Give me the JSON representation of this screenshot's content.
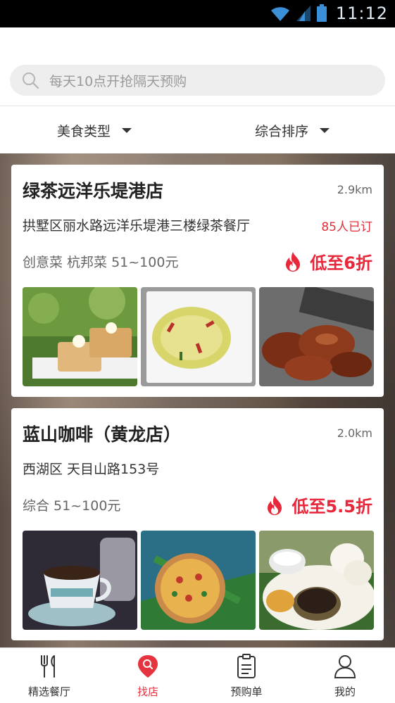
{
  "status_bar": {
    "time": "11:12"
  },
  "search": {
    "placeholder": "每天10点开抢隔天预购"
  },
  "filters": [
    {
      "label": "美食类型"
    },
    {
      "label": "综合排序"
    }
  ],
  "restaurants": [
    {
      "name": "绿茶远洋乐堤港店",
      "distance": "2.9km",
      "address": "拱墅区丽水路远洋乐堤港三楼绿茶餐厅",
      "booked": "85人已订",
      "tags": "创意菜 杭邦菜  51~100元",
      "discount": "低至6折",
      "photos": [
        "toast-dessert",
        "shredded-potato",
        "roast-chicken-wings"
      ]
    },
    {
      "name": "蓝山咖啡（黄龙店）",
      "distance": "2.0km",
      "address": "西湖区 天目山路153号",
      "booked": "",
      "tags": "综合  51~100元",
      "discount": "低至5.5折",
      "photos": [
        "coffee-cup",
        "pizza",
        "steamed-buns-set"
      ]
    }
  ],
  "tabbar": [
    {
      "label": "精选餐厅",
      "icon": "fork-knife-icon",
      "active": false
    },
    {
      "label": "找店",
      "icon": "location-search-icon",
      "active": true
    },
    {
      "label": "预购单",
      "icon": "clipboard-icon",
      "active": false
    },
    {
      "label": "我的",
      "icon": "person-icon",
      "active": false
    }
  ],
  "colors": {
    "accent": "#e5343f",
    "discount": "#e8283a"
  }
}
